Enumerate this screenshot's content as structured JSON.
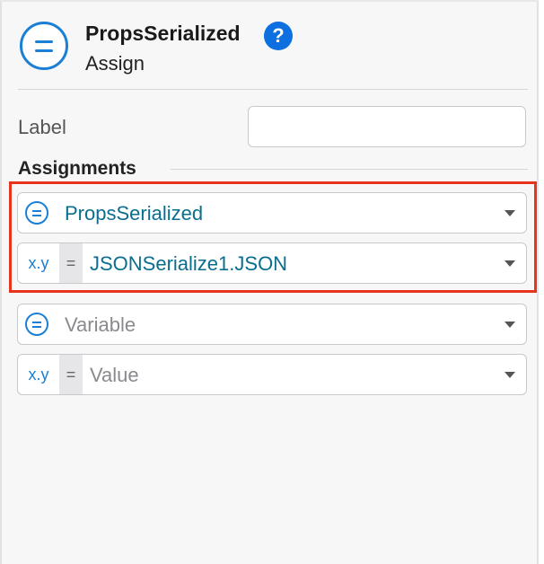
{
  "header": {
    "title": "PropsSerialized",
    "subtitle": "Assign",
    "help_label": "?"
  },
  "label_field": {
    "label": "Label",
    "value": ""
  },
  "assignments": {
    "heading": "Assignments",
    "rows": [
      {
        "variable": "PropsSerialized",
        "value_prefix": "x.y",
        "equals": "=",
        "value": "JSONSerialize1.JSON"
      },
      {
        "variable": "Variable",
        "value_prefix": "x.y",
        "equals": "=",
        "value": "Value"
      }
    ]
  },
  "colors": {
    "accent": "#1b7fd6",
    "value_text": "#0a6e8f",
    "highlight": "#e8341c",
    "help": "#0e6fe0"
  }
}
